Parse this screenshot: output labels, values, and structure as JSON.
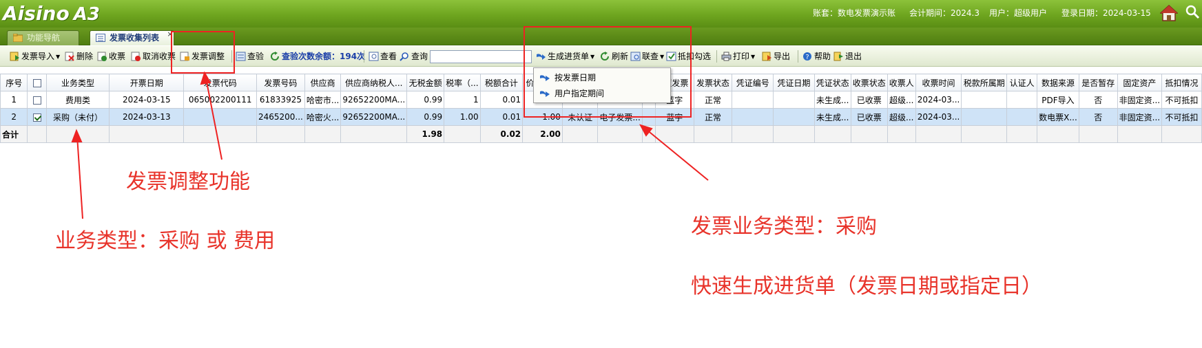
{
  "header": {
    "logo_text": "Aisino",
    "logo_suffix": "A3",
    "account_label": "账套：数电发票演示账",
    "period_label": "会计期间：2024.3",
    "user_label": "用户：超级用户",
    "login_date_label": "登录日期：2024-03-15"
  },
  "tabs": [
    {
      "label": "功能导航",
      "active": false
    },
    {
      "label": "发票收集列表",
      "active": true
    }
  ],
  "tab_close_glyph": "×",
  "toolbar": {
    "import": "发票导入",
    "delete": "删除",
    "receive": "收票",
    "cancel_receive": "取消收票",
    "adjust": "发票调整",
    "verify": "查验",
    "verify_remaining": "查验次数余额：194次",
    "view": "查看",
    "query": "查询",
    "generate": "生成进货单",
    "refresh": "刷新",
    "link_query": "联查",
    "deduct_check": "抵扣勾选",
    "print": "打印",
    "export": "导出",
    "help": "帮助",
    "exit": "退出"
  },
  "dropdown": {
    "items": [
      "按发票日期",
      "用户指定期间"
    ]
  },
  "grid": {
    "columns": [
      "序号",
      "",
      "业务类型",
      "开票日期",
      "发票代码",
      "发票号码",
      "供应商",
      "供应商纳税人...",
      "无税金额",
      "税率（...",
      "税额合计",
      "价税合计",
      "",
      "",
      "",
      "/蓝发票",
      "发票状态",
      "凭证编号",
      "凭证日期",
      "凭证状态",
      "收票状态",
      "收票人",
      "收票时间",
      "税款所属期",
      "认证人",
      "数据来源",
      "是否暂存",
      "固定资产",
      "抵扣情况"
    ],
    "rows": [
      {
        "selected": false,
        "checked": false,
        "cells": [
          "1",
          "",
          "费用类",
          "2024-03-15",
          "065002200111",
          "61833925",
          "哈密市...",
          "92652200MA...",
          "0.99",
          "1",
          "0.01",
          "",
          "",
          "",
          "",
          "蓝字",
          "正常",
          "",
          "",
          "未生成...",
          "已收票",
          "超级...",
          "2024-03...",
          "",
          "",
          "PDF导入",
          "否",
          "非固定资...",
          "不可抵扣"
        ]
      },
      {
        "selected": true,
        "checked": true,
        "cells": [
          "2",
          "",
          "采购（未付）",
          "2024-03-13",
          "",
          "2465200...",
          "哈密火...",
          "92652200MA...",
          "0.99",
          "1.00",
          "0.01",
          "1.00",
          "未认证",
          "电子发票...",
          "",
          "蓝字",
          "正常",
          "",
          "",
          "未生成...",
          "已收票",
          "超级...",
          "2024-03...",
          "",
          "",
          "数电票X...",
          "否",
          "非固定资...",
          "不可抵扣"
        ]
      }
    ],
    "total": {
      "label": "合计",
      "amount": "1.98",
      "tax": "0.02",
      "total": "2.00"
    }
  },
  "annotations": {
    "adjust_feature": "发票调整功能",
    "business_type": "业务类型：采购 或 费用",
    "invoice_business_type": "发票业务类型：采购",
    "quick_generate": "快速生成进货单（发票日期或指定日）"
  },
  "colors": {
    "header_green": "#6ea51f",
    "annotation_red": "#e8332a",
    "selected_row": "#cfe3f7"
  },
  "icons": {
    "home": "home-icon",
    "search": "search-icon"
  }
}
